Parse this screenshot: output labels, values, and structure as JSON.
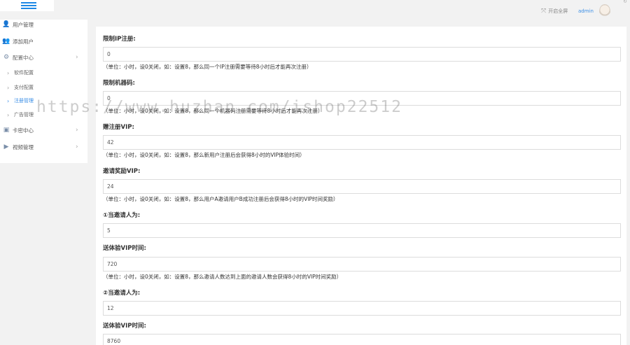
{
  "header": {
    "fullscreen_label": "开启全屏",
    "admin_label": "admin"
  },
  "sidebar": {
    "items": [
      {
        "label": "用户管理",
        "icon": "user-icon"
      },
      {
        "label": "添加用户",
        "icon": "add-user-icon"
      },
      {
        "label": "配置中心",
        "icon": "gear-icon"
      },
      {
        "label": "卡密中心",
        "icon": "card-icon"
      },
      {
        "label": "视频管理",
        "icon": "play-icon"
      }
    ],
    "sub_items": [
      {
        "label": "软件配置"
      },
      {
        "label": "支付配置"
      },
      {
        "label": "注册管理"
      },
      {
        "label": "广告管理"
      }
    ]
  },
  "form": {
    "fields": [
      {
        "label": "限制IP注册:",
        "value": "0",
        "hint": "（单位：小时，设0关闭，如：设置8，那么同一个IP注册需要等待8小时后才能再次注册）"
      },
      {
        "label": "限制机器码:",
        "value": "0",
        "hint": "（单位：小时，设0关闭，如：设置8，那么同一个机器码注册需要等待8小时后才能再次注册）"
      },
      {
        "label": "赠注册VIP:",
        "value": "42",
        "hint": "（单位：小时，设0关闭，如：设置8，那么新用户注册后会获得8小时的VIP体验时间）"
      },
      {
        "label": "邀请奖励VIP:",
        "value": "24",
        "hint": "（单位：小时，设0关闭，如：设置8，那么用户A邀请用户B成功注册后会获得8小时的VIP时间奖励）"
      },
      {
        "label": "①当邀请人为:",
        "value": "5",
        "hint": ""
      },
      {
        "label": "送体验VIP时间:",
        "value": "720",
        "hint": "（单位：小时，设0关闭，如：设置8，那么邀请人数达到上面的邀请人数会获得8小时的VIP时间奖励）"
      },
      {
        "label": "②当邀请人为:",
        "value": "12",
        "hint": ""
      },
      {
        "label": "送体验VIP时间:",
        "value": "8760",
        "hint": ""
      }
    ]
  },
  "watermark": "https://www.huzhan.com/ishop22512"
}
